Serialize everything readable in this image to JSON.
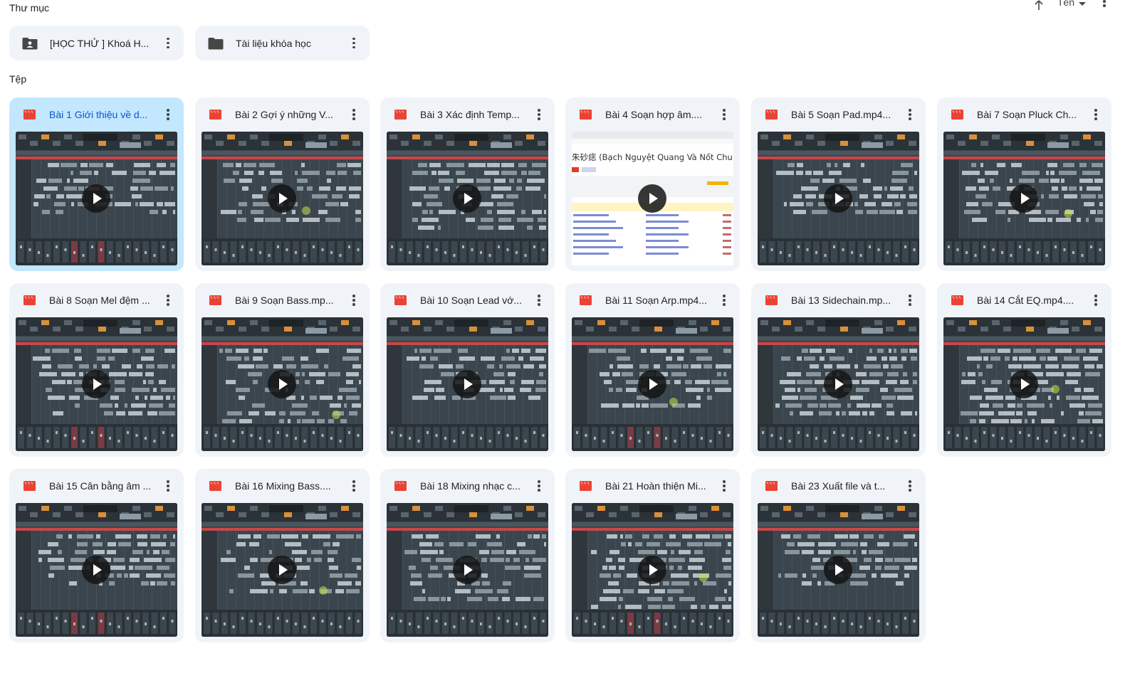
{
  "sections": {
    "folders_label": "Thư mục",
    "files_label": "Tệp"
  },
  "sort": {
    "label": "Tên"
  },
  "folders": [
    {
      "name": "[HỌC THỬ ] Khoá H...",
      "icon": "shared-folder-icon"
    },
    {
      "name": "Tài liệu khóa học",
      "icon": "folder-icon"
    }
  ],
  "files": [
    {
      "name": "Bài 1 Giới thiệu về d...",
      "selected": true
    },
    {
      "name": "Bài 2 Gợi ý những V..."
    },
    {
      "name": "Bài 3 Xác định Temp..."
    },
    {
      "name": "Bài 4 Soạn hợp âm...."
    },
    {
      "name": "Bài 5 Soạn Pad.mp4..."
    },
    {
      "name": "Bài 7 Soạn Pluck Ch..."
    },
    {
      "name": "Bài 8 Soạn Mel đệm ..."
    },
    {
      "name": "Bài 9 Soạn Bass.mp..."
    },
    {
      "name": "Bài 10 Soạn Lead vớ..."
    },
    {
      "name": "Bài 11 Soạn Arp.mp4..."
    },
    {
      "name": "Bài 13 Sidechain.mp..."
    },
    {
      "name": "Bài 14 Cắt EQ.mp4...."
    },
    {
      "name": "Bài 15 Cân bằng âm ..."
    },
    {
      "name": "Bài 16 Mixing Bass...."
    },
    {
      "name": "Bài 18 Mixing nhạc c..."
    },
    {
      "name": "Bài 21 Hoàn thiện Mi..."
    },
    {
      "name": "Bài 23 Xuất file và t..."
    }
  ],
  "doc_preview_title": "朱砂痣 (Bạch Nguyệt Quang Và Nốt Chu Sa)",
  "colors": {
    "card_bg": "#f0f4f9",
    "selected_bg": "#c2e7ff",
    "video_icon": "#ea4335",
    "daw_bg": "#3a454d"
  }
}
